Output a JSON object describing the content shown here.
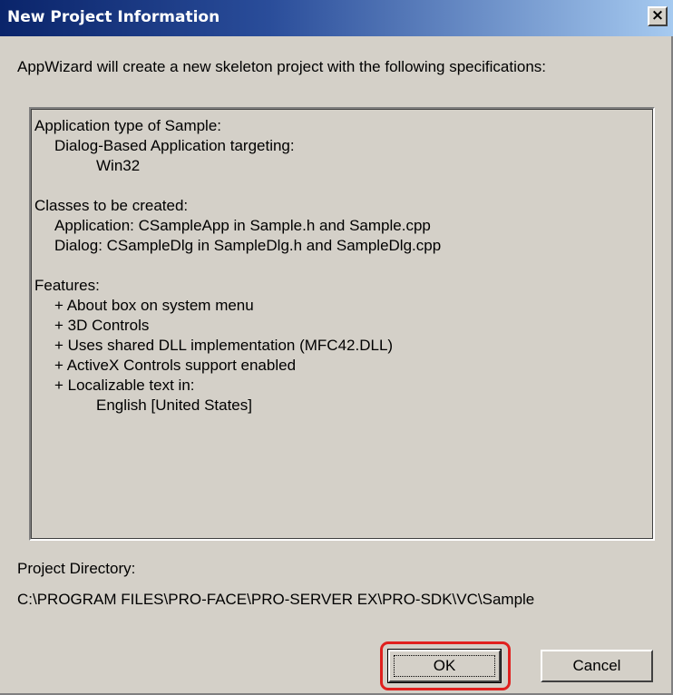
{
  "window": {
    "title": "New Project Information",
    "close_glyph": "×"
  },
  "intro_text": "AppWizard will create a new skeleton project with the following specifications:",
  "specification": {
    "lines": [
      "Application type of Sample:",
      "Dialog-Based Application targeting:",
      "Win32",
      "",
      "Classes to be created:",
      "Application: CSampleApp in Sample.h and Sample.cpp",
      "Dialog: CSampleDlg in SampleDlg.h and SampleDlg.cpp",
      "",
      "Features:",
      "+ About box on system menu",
      "+ 3D Controls",
      "+ Uses shared DLL implementation (MFC42.DLL)",
      "+ ActiveX Controls support enabled",
      "+ Localizable text in:",
      "English [United States]"
    ]
  },
  "project_directory": {
    "label": "Project Directory:",
    "path": "C:\\PROGRAM FILES\\PRO-FACE\\PRO-SERVER EX\\PRO-SDK\\VC\\Sample"
  },
  "buttons": {
    "ok_label": "OK",
    "cancel_label": "Cancel"
  },
  "colors": {
    "title_bar_start": "#0a246a",
    "dialog_face": "#d4d0c8",
    "highlight_ring": "#e0201e"
  }
}
